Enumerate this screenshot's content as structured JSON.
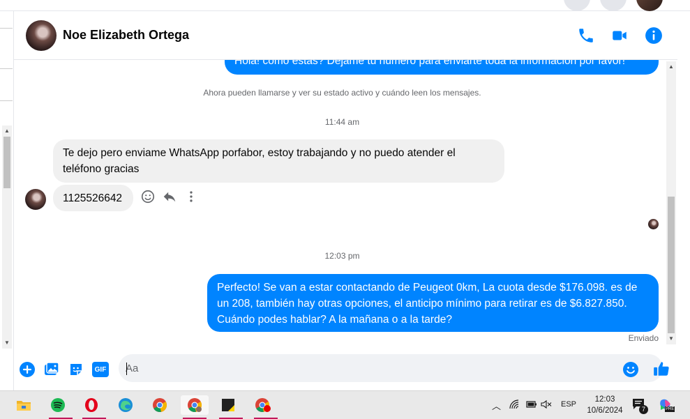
{
  "header": {
    "contact_name": "Noe Elizabeth Ortega"
  },
  "messages": {
    "top_cut_text": "Hola! cómo estas? Dejame tu número para enviarte toda la información por favor!",
    "system_notice": "Ahora pueden llamarse y ver su estado activo y cuándo leen los mensajes.",
    "time_1": "11:44 am",
    "incoming_1": "Te dejo pero enviame WhatsApp porfabor, estoy trabajando y no puedo atender el teléfono gracias",
    "incoming_2": "1125526642",
    "time_2": "12:03 pm",
    "outgoing_1": "Perfecto!  Se van a estar contactando de Peugeot 0km, La cuota desde $176.098. es de un 208, también hay otras opciones, el anticipo mínimo para retirar es de $6.827.850. Cuándo podes hablar? A la mañana o a la tarde?",
    "status": "Enviado"
  },
  "composer": {
    "placeholder": "Aa",
    "gif_label": "GIF"
  },
  "taskbar": {
    "language": "ESP",
    "time": "12:03",
    "date": "10/6/2024",
    "notification_count": "7",
    "copilot_badge": "PRE"
  },
  "colors": {
    "accent": "#0084ff",
    "incoming_bubble": "#f0f0f0"
  }
}
